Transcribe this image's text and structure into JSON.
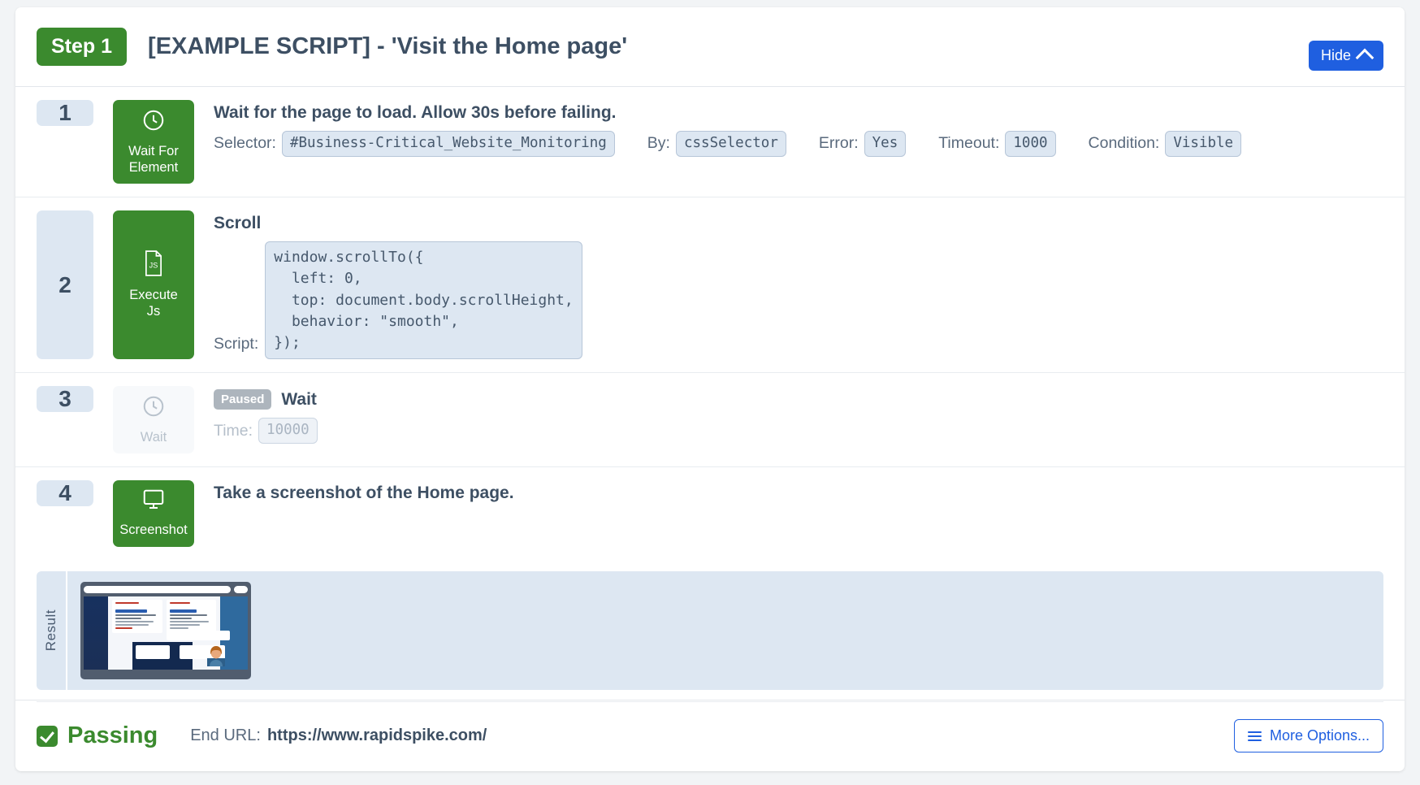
{
  "header": {
    "step_badge": "Step 1",
    "title": "[EXAMPLE SCRIPT] - 'Visit the Home page'",
    "hide_label": "Hide"
  },
  "steps": [
    {
      "number": "1",
      "type_label_line1": "Wait For",
      "type_label_line2": "Element",
      "icon": "clock-icon",
      "title": "Wait for the page to load. Allow 30s before failing.",
      "paused": false,
      "params": [
        {
          "label": "Selector:",
          "value": "#Business-Critical_Website_Monitoring"
        },
        {
          "label": "By:",
          "value": "cssSelector"
        },
        {
          "label": "Error:",
          "value": "Yes"
        },
        {
          "label": "Timeout:",
          "value": "1000"
        },
        {
          "label": "Condition:",
          "value": "Visible"
        }
      ]
    },
    {
      "number": "2",
      "type_label_line1": "Execute",
      "type_label_line2": "Js",
      "icon": "js-file-icon",
      "title": "Scroll",
      "paused": false,
      "script_label": "Script:",
      "script": "window.scrollTo({\n  left: 0,\n  top: document.body.scrollHeight,\n  behavior: \"smooth\",\n});"
    },
    {
      "number": "3",
      "type_label_line1": "Wait",
      "type_label_line2": "",
      "icon": "clock-icon",
      "title": "Wait",
      "paused": true,
      "paused_badge": "Paused",
      "params": [
        {
          "label": "Time:",
          "value": "10000"
        }
      ]
    },
    {
      "number": "4",
      "type_label_line1": "Screenshot",
      "type_label_line2": "",
      "icon": "monitor-icon",
      "title": "Take a screenshot of the Home page.",
      "paused": false,
      "params": []
    }
  ],
  "result": {
    "label": "Result",
    "thumbnail_alt": "screenshot-thumbnail"
  },
  "footer": {
    "status": "Passing",
    "status_icon": "check-icon",
    "end_url_label": "End URL:",
    "end_url": "https://www.rapidspike.com/",
    "more_options_label": "More Options..."
  },
  "colors": {
    "green": "#3b8a2e",
    "blue": "#1f5fe0",
    "pill_bg": "#dde7f2",
    "text": "#3d4f63"
  }
}
